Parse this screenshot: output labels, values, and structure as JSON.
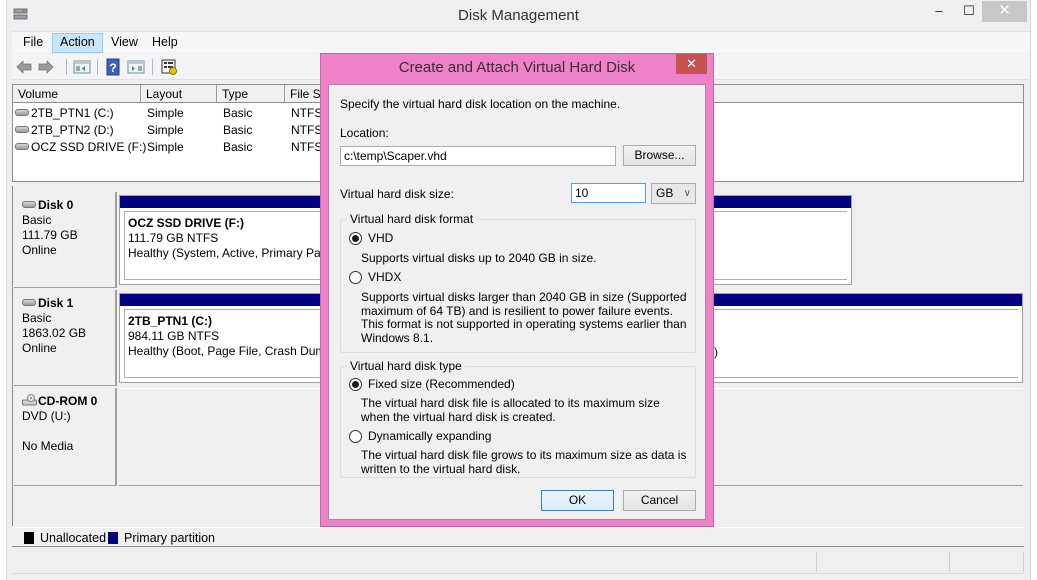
{
  "window": {
    "title": "Disk Management",
    "controls": {
      "minimize": "–",
      "maximize": "☐",
      "close": "✕"
    }
  },
  "menu": [
    {
      "label": "File",
      "active": false
    },
    {
      "label": "Action",
      "active": true
    },
    {
      "label": "View",
      "active": false
    },
    {
      "label": "Help",
      "active": false
    }
  ],
  "toolbar": {
    "icons": [
      "back-arrow-icon",
      "forward-arrow-icon",
      "show-hide-console-tree-icon",
      "help-icon",
      "show-hide-action-pane-icon",
      "properties-icon"
    ]
  },
  "volume_list": {
    "columns": [
      "Volume",
      "Layout",
      "Type",
      "File Sy"
    ],
    "rows": [
      {
        "volume": "2TB_PTN1 (C:)",
        "layout": "Simple",
        "type": "Basic",
        "fs": "NTFS"
      },
      {
        "volume": "2TB_PTN2 (D:)",
        "layout": "Simple",
        "type": "Basic",
        "fs": "NTFS"
      },
      {
        "volume": "OCZ SSD DRIVE (F:)",
        "layout": "Simple",
        "type": "Basic",
        "fs": "NTFS"
      }
    ]
  },
  "disks": [
    {
      "name": "Disk 0",
      "kind": "Basic",
      "size": "111.79 GB",
      "status": "Online",
      "partition": {
        "title": "OCZ SSD DRIVE  (F:)",
        "size": "111.79 GB NTFS",
        "health": "Healthy (System, Active, Primary Part"
      }
    },
    {
      "name": "Disk 1",
      "kind": "Basic",
      "size": "1863.02 GB",
      "status": "Online",
      "partition": {
        "title": "2TB_PTN1  (C:)",
        "size": "984.11 GB NTFS",
        "health": "Healthy (Boot, Page File, Crash Dump"
      },
      "partition_tail": ")"
    },
    {
      "name": "CD-ROM 0",
      "kind": "DVD (U:)",
      "size": "",
      "status": "No Media"
    }
  ],
  "legend": [
    {
      "label": "Unallocated",
      "color": "#000000"
    },
    {
      "label": "Primary partition",
      "color": "#000080"
    }
  ],
  "dialog": {
    "title": "Create and Attach Virtual Hard Disk",
    "close": "✕",
    "intro": "Specify the virtual hard disk location on the machine.",
    "location_label": "Location:",
    "location_value": "c:\\temp\\Scaper.vhd",
    "browse_label": "Browse...",
    "size_label": "Virtual hard disk size:",
    "size_value": "10",
    "size_unit": "GB",
    "format": {
      "title": "Virtual hard disk format",
      "options": [
        {
          "label": "VHD",
          "checked": true,
          "description": "Supports virtual disks up to 2040 GB in size."
        },
        {
          "label": "VHDX",
          "checked": false,
          "description": "Supports virtual disks larger than 2040 GB in size (Supported maximum of 64 TB) and is resilient to power failure events. This format is not supported in operating systems earlier than Windows 8.1."
        }
      ]
    },
    "type": {
      "title": "Virtual hard disk type",
      "options": [
        {
          "label": "Fixed size (Recommended)",
          "checked": true,
          "description": "The virtual hard disk file is allocated to its maximum size when the virtual hard disk is created."
        },
        {
          "label": "Dynamically expanding",
          "checked": false,
          "description": "The virtual hard disk file grows to its maximum size as data is written to the virtual hard disk."
        }
      ]
    },
    "ok_label": "OK",
    "cancel_label": "Cancel",
    "accent_color": "#ee82c8"
  }
}
